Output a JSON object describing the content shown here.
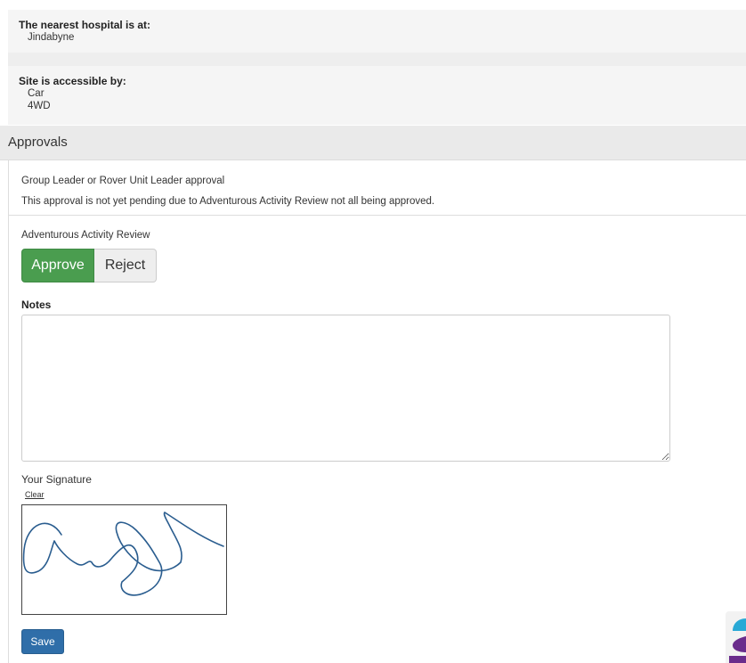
{
  "hospital": {
    "label": "The nearest hospital is at:",
    "value": "Jindabyne"
  },
  "access": {
    "label": "Site is accessible by:",
    "values": [
      "Car",
      "4WD"
    ]
  },
  "approvals": {
    "title": "Approvals",
    "approval_name": "Group Leader or Rover Unit Leader approval",
    "approval_status": "This approval is not yet pending due to Adventurous Activity Review not all being approved.",
    "review_label": "Adventurous Activity Review",
    "approve_label": "Approve",
    "reject_label": "Reject",
    "notes_label": "Notes",
    "notes_value": "",
    "signature_label": "Your Signature",
    "clear_label": "Clear",
    "save_label": "Save"
  },
  "colors": {
    "approve": "#4a9d4f",
    "save": "#2f6ea9",
    "signature_ink": "#2a5d8f",
    "widget_teal": "#29a9d6",
    "widget_purple": "#6a2c8c"
  },
  "icons": {
    "corner_widget": "help-widget-icon"
  }
}
